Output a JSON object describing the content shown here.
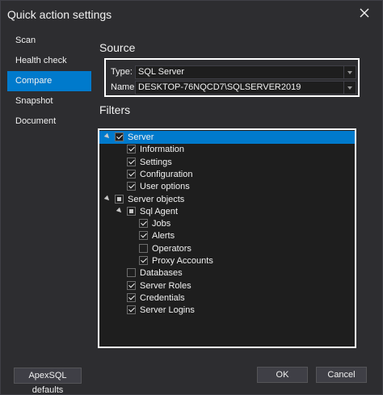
{
  "window": {
    "title": "Quick action settings"
  },
  "nav": {
    "items": [
      {
        "label": "Scan",
        "active": false
      },
      {
        "label": "Health check",
        "active": false
      },
      {
        "label": "Compare",
        "active": true
      },
      {
        "label": "Snapshot",
        "active": false
      },
      {
        "label": "Document",
        "active": false
      }
    ]
  },
  "source": {
    "heading": "Source",
    "type_label": "Type:",
    "type_value": "SQL Server",
    "name_label": "Name:",
    "name_value": "DESKTOP-76NQCD7\\SQLSERVER2019"
  },
  "filters": {
    "heading": "Filters",
    "tree": [
      {
        "label": "Server",
        "level": 0,
        "expandable": true,
        "state": "checked",
        "selected": true
      },
      {
        "label": "Information",
        "level": 1,
        "expandable": false,
        "state": "checked",
        "selected": false
      },
      {
        "label": "Settings",
        "level": 1,
        "expandable": false,
        "state": "checked",
        "selected": false
      },
      {
        "label": "Configuration",
        "level": 1,
        "expandable": false,
        "state": "checked",
        "selected": false
      },
      {
        "label": "User options",
        "level": 1,
        "expandable": false,
        "state": "checked",
        "selected": false
      },
      {
        "label": "Server objects",
        "level": 0,
        "expandable": true,
        "state": "partial",
        "selected": false
      },
      {
        "label": "Sql Agent",
        "level": 1,
        "expandable": true,
        "state": "partial",
        "selected": false
      },
      {
        "label": "Jobs",
        "level": 2,
        "expandable": false,
        "state": "checked",
        "selected": false
      },
      {
        "label": "Alerts",
        "level": 2,
        "expandable": false,
        "state": "checked",
        "selected": false
      },
      {
        "label": "Operators",
        "level": 2,
        "expandable": false,
        "state": "unchecked",
        "selected": false
      },
      {
        "label": "Proxy Accounts",
        "level": 2,
        "expandable": false,
        "state": "checked",
        "selected": false
      },
      {
        "label": "Databases",
        "level": 1,
        "expandable": false,
        "state": "unchecked",
        "selected": false
      },
      {
        "label": "Server Roles",
        "level": 1,
        "expandable": false,
        "state": "checked",
        "selected": false
      },
      {
        "label": "Credentials",
        "level": 1,
        "expandable": false,
        "state": "checked",
        "selected": false
      },
      {
        "label": "Server Logins",
        "level": 1,
        "expandable": false,
        "state": "checked",
        "selected": false
      }
    ]
  },
  "buttons": {
    "defaults_label": "ApexSQL defaults",
    "ok_label": "OK",
    "cancel_label": "Cancel"
  },
  "colors": {
    "accent": "#007acc",
    "background": "#2d2d30",
    "panel": "#1e1e1e",
    "text": "#f1f1f1"
  }
}
